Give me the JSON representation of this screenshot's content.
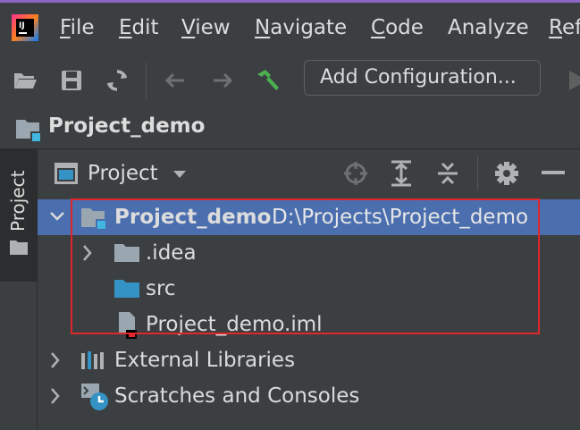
{
  "menu": {
    "items": [
      {
        "first": "F",
        "rest": "ile"
      },
      {
        "first": "E",
        "rest": "dit"
      },
      {
        "first": "V",
        "rest": "iew"
      },
      {
        "first": "N",
        "rest": "avigate"
      },
      {
        "first": "C",
        "rest": "ode"
      },
      {
        "first": "",
        "rest": "Analyze"
      },
      {
        "first": "R",
        "rest": "ef"
      }
    ]
  },
  "toolbar": {
    "config_label": "Add Configuration..."
  },
  "breadcrumb": {
    "project_name": "Project_demo"
  },
  "tool_strip": {
    "label": "Project"
  },
  "panel": {
    "title": "Project"
  },
  "tree": {
    "root": {
      "name": "Project_demo",
      "path": "D:\\Projects\\Project_demo"
    },
    "children": [
      {
        "name": ".idea"
      },
      {
        "name": "src"
      },
      {
        "name": "Project_demo.iml"
      }
    ],
    "external_libraries": "External Libraries",
    "scratches": "Scratches and Consoles"
  },
  "colors": {
    "accent_selection": "#4b6eaf",
    "highlight_box": "#e0262b",
    "build_icon": "#4caf50"
  }
}
